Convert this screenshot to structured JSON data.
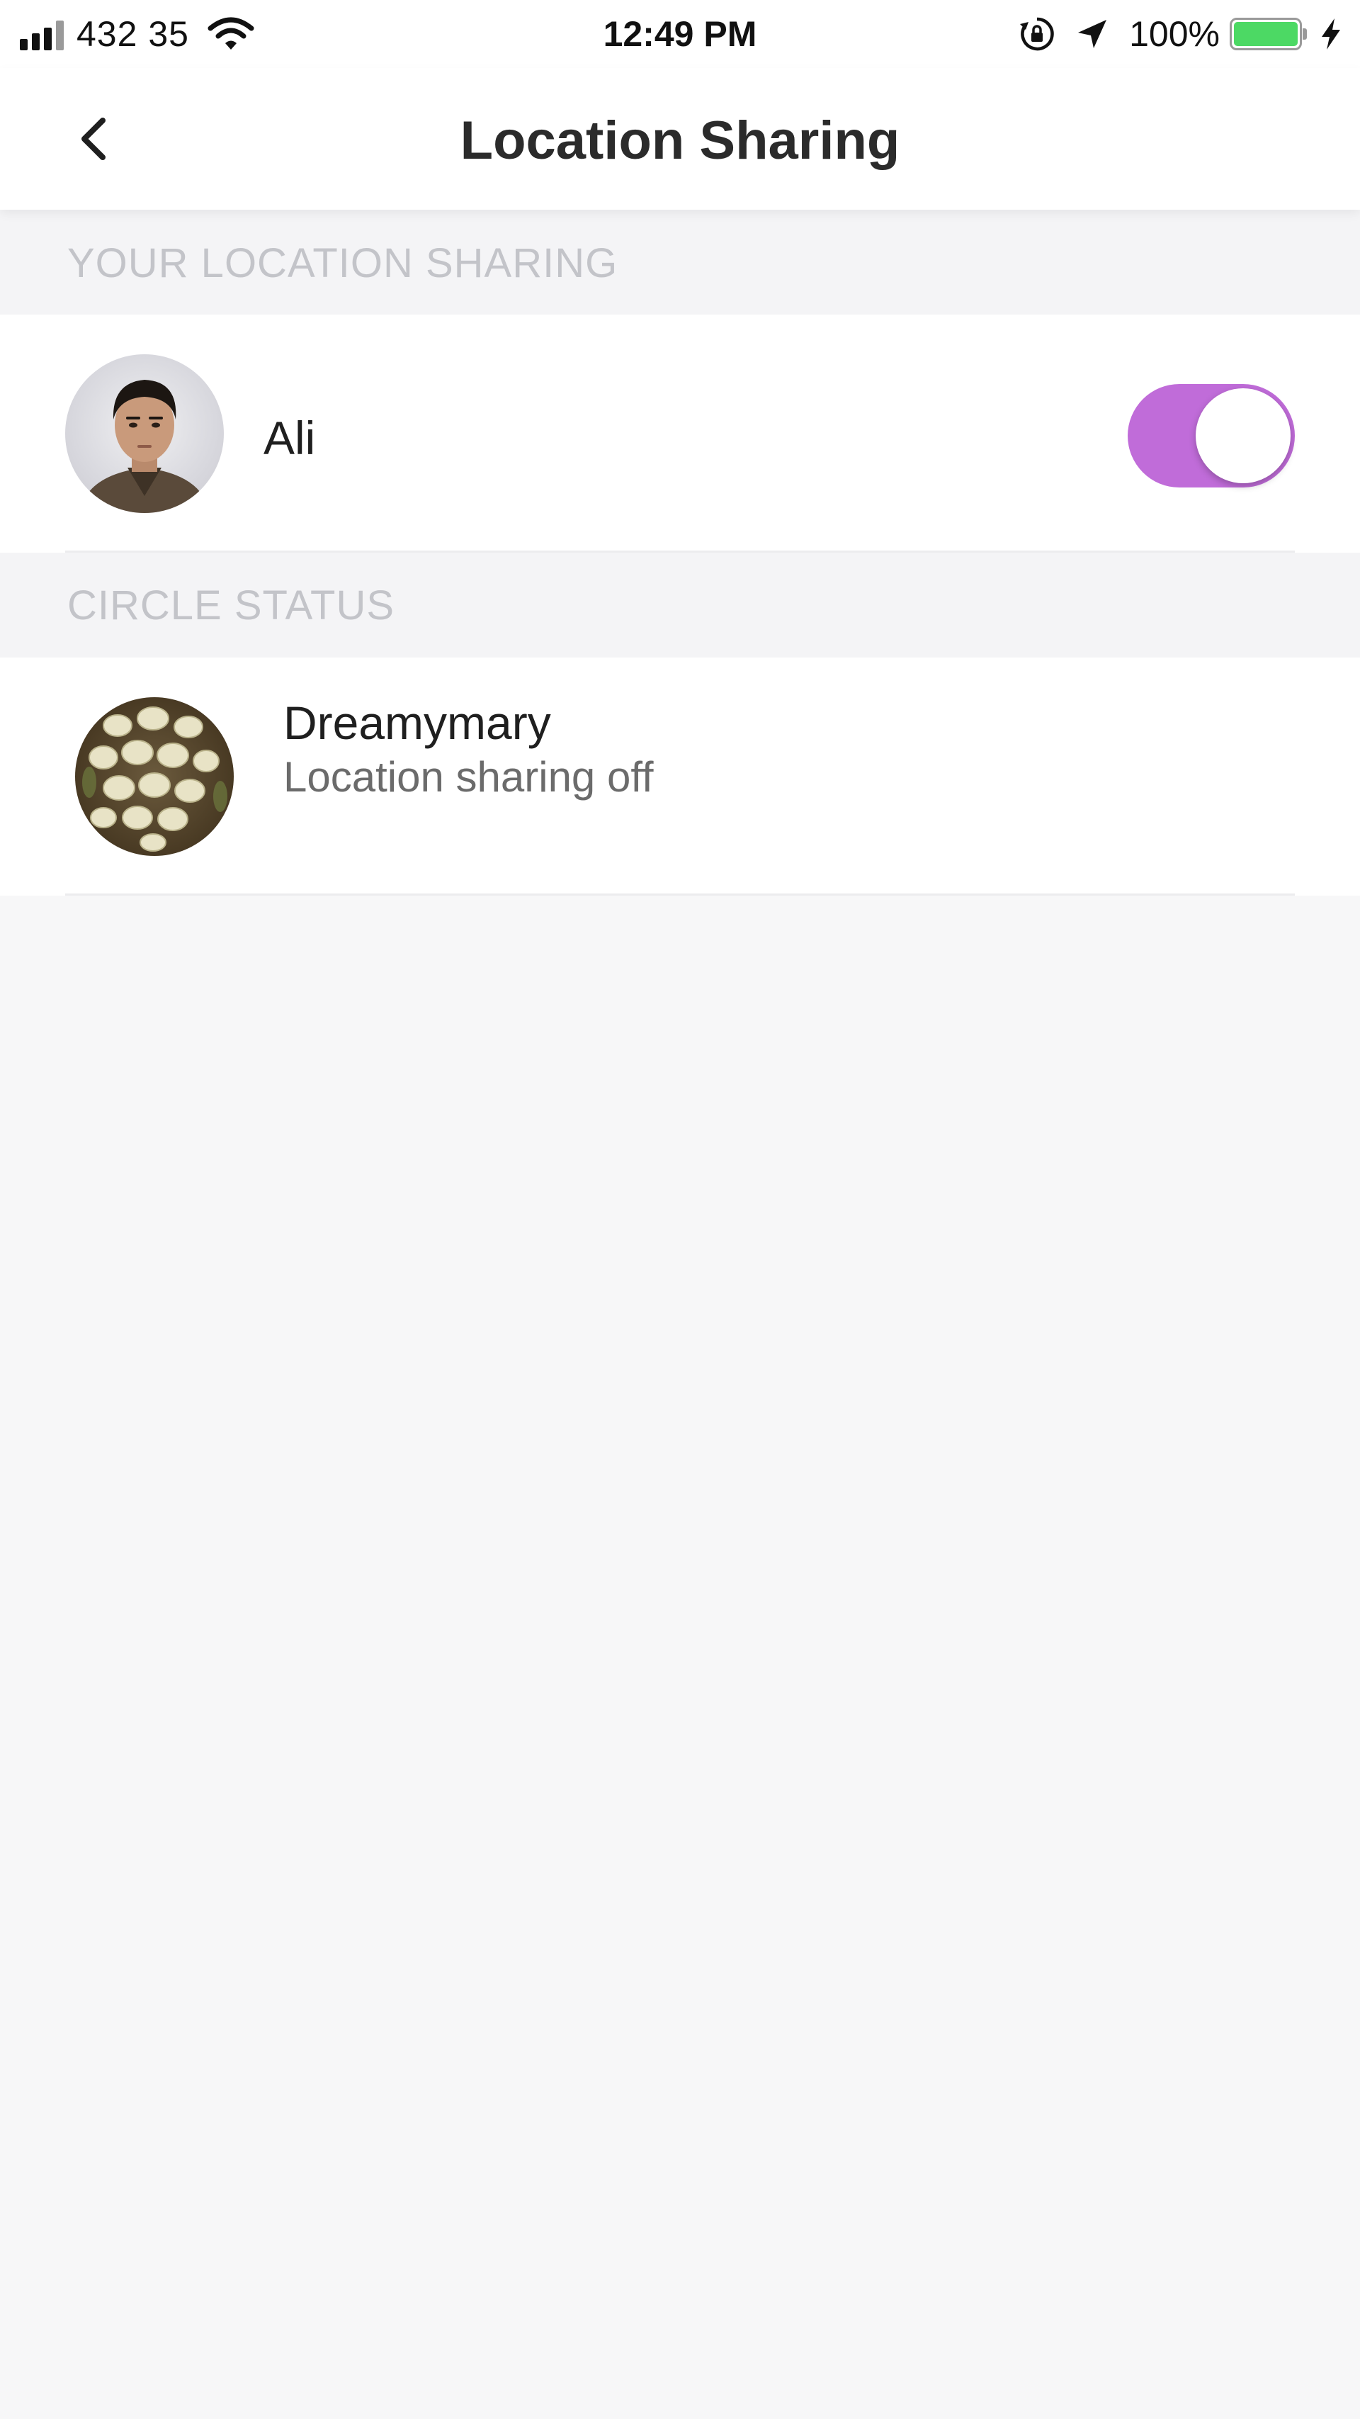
{
  "status_bar": {
    "carrier": "432 35",
    "time": "12:49 PM",
    "battery_percent": "100%",
    "battery_level": 1.0,
    "battery_color": "#4cd964",
    "icons": [
      "signal-icon",
      "wifi-icon",
      "orientation-lock-icon",
      "location-arrow-icon",
      "battery-icon",
      "charging-bolt-icon"
    ]
  },
  "nav": {
    "back_icon": "chevron-left-icon",
    "title": "Location Sharing"
  },
  "your_location_section": {
    "header": "YOUR LOCATION SHARING",
    "user": {
      "name": "Ali",
      "sharing_enabled": true,
      "toggle_color": "#c06cd9"
    }
  },
  "circle_status_section": {
    "header": "CIRCLE STATUS",
    "members": [
      {
        "name": "Dreamymary",
        "status": "Location sharing off"
      }
    ]
  }
}
